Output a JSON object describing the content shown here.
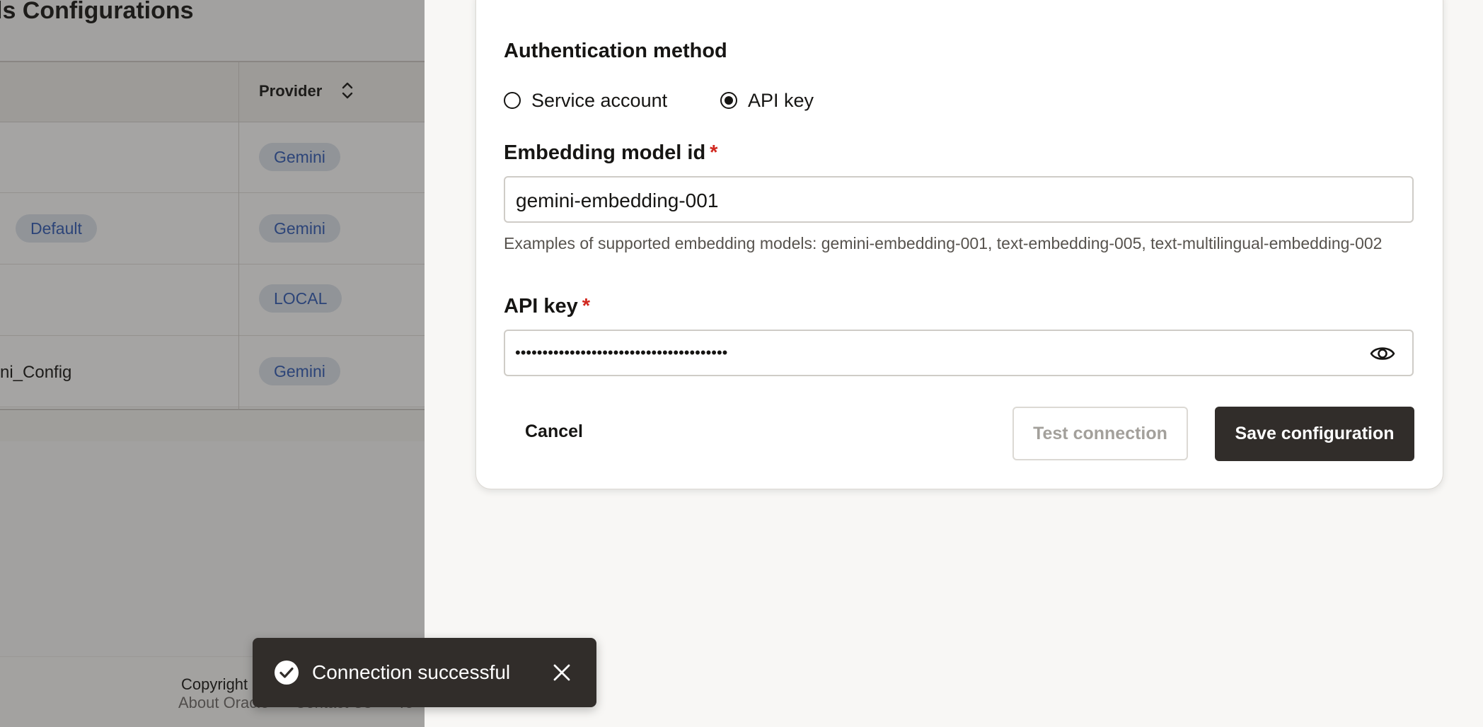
{
  "background": {
    "page_title": "ls Configurations",
    "table": {
      "provider_header": "Provider",
      "rows": [
        {
          "name": "",
          "badge": "",
          "provider": "Gemini"
        },
        {
          "name": "",
          "badge": "Default",
          "provider": "Gemini"
        },
        {
          "name": "",
          "badge": "",
          "provider": "LOCAL"
        },
        {
          "name": "ni_Config",
          "badge": "",
          "provider": "Gemini"
        }
      ]
    },
    "footer": {
      "copyright": "Copyright",
      "links": [
        "About Oracle",
        "Contact Us",
        "Te"
      ]
    }
  },
  "form": {
    "auth_label": "Authentication method",
    "auth_options": [
      {
        "label": "Service account",
        "selected": false
      },
      {
        "label": "API key",
        "selected": true
      }
    ],
    "embedding_label": "Embedding model id",
    "embedding_value": "gemini-embedding-001",
    "embedding_help": "Examples of supported embedding models: gemini-embedding-001, text-embedding-005, text-multilingual-embedding-002",
    "api_key_label": "API key",
    "api_key_masked": "•••••••••••••••••••••••••••••••••••••••",
    "required_mark": "*",
    "cancel_label": "Cancel",
    "test_label": "Test connection",
    "save_label": "Save configuration"
  },
  "toast": {
    "message": "Connection successful",
    "icon": "check-circle-icon"
  },
  "colors": {
    "primary_button": "#312d2a",
    "badge_bg": "#dde3ec",
    "badge_text": "#2f5bb5",
    "required": "#d1281f"
  }
}
